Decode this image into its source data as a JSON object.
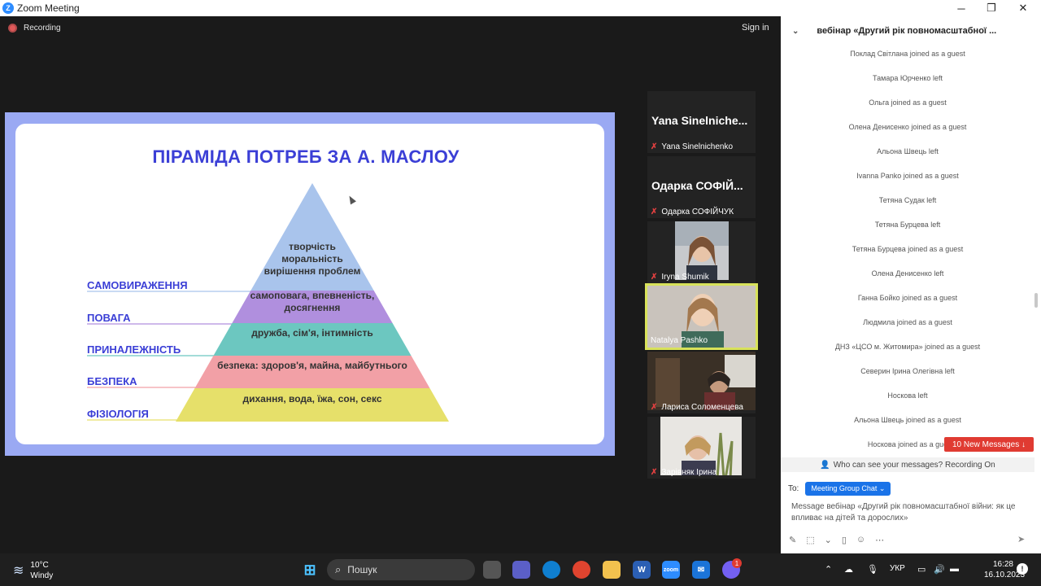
{
  "window": {
    "title": "Zoom Meeting",
    "logo_letter": "Z",
    "minimize": "─",
    "maximize": "❐",
    "close": "✕"
  },
  "meeting": {
    "recording_label": "Recording",
    "signin_label": "Sign in"
  },
  "slide": {
    "title": "ПІРАМІДА ПОТРЕБ ЗА А. МАСЛОУ",
    "levels": [
      {
        "label": "САМОВИРАЖЕННЯ",
        "lines": [
          "творчість",
          "моральність",
          "вирішення проблем"
        ],
        "color": "#a9c4ec"
      },
      {
        "label": "ПОВАГА",
        "lines": [
          "самоповага, впевненість,",
          "досягнення"
        ],
        "color": "#b08fde"
      },
      {
        "label": "ПРИНАЛЕЖНІСТЬ",
        "lines": [
          "дружба, сім'я, інтимність"
        ],
        "color": "#6cc7c0"
      },
      {
        "label": "БЕЗПЕКА",
        "lines": [
          "безпека: здоров'я, майна, майбутнього"
        ],
        "color": "#f2a0a6"
      },
      {
        "label": "ФІЗІОЛОГІЯ",
        "lines": [
          "дихання, вода, їжа, сон, секс"
        ],
        "color": "#e6e06a"
      }
    ]
  },
  "participants": [
    {
      "display": "Yana  Sinelniche...",
      "name": "Yana Sinelnichenko",
      "muted": true,
      "video": false
    },
    {
      "display": "Одарка  СОФІЙ...",
      "name": "Одарка СОФІЙЧУК",
      "muted": true,
      "video": false
    },
    {
      "name": "Iryna Shumik",
      "muted": true,
      "video": true
    },
    {
      "name": "Natalya Pashko",
      "muted": false,
      "video": true,
      "active": true
    },
    {
      "name": "Лариса Соломенцева",
      "muted": true,
      "video": true
    },
    {
      "name": "Зарівняк Ірина",
      "muted": true,
      "video": true
    }
  ],
  "chat": {
    "title": "вебінар «Другий рік повномасштабної ...",
    "messages": [
      "Поклад Світлана joined as a guest",
      "Тамара Юрченко left",
      "Ольга joined as a guest",
      "Олена Денисенко joined as a guest",
      "Альона Швець left",
      "Ivanna Panko joined as a guest",
      "Тетяна Судак left",
      "Тетяна Бурцева left",
      "Тетяна Бурцева joined as a guest",
      "Олена Денисенко left",
      "Ганна  Бойко joined as a guest",
      "Людмила joined as a guest",
      "ДНЗ «ЦСО м. Житомира» joined as a guest",
      "Северин Ірина Олегівна left",
      "Носкова left",
      "Альона Швець joined as a guest",
      "Носкова joined as a gue"
    ],
    "new_messages": "10 New Messages ↓",
    "privacy_note": "Who can see your messages? Recording On",
    "to_label": "To:",
    "to_value": "Meeting Group Chat ⌄",
    "input_placeholder": "Message вебінар «Другий рік повномасштабної війни: як це впливає на дітей та дорослих»"
  },
  "taskbar": {
    "weather_temp": "10°C",
    "weather_desc": "Windy",
    "search_placeholder": "Пошук",
    "language": "УКР",
    "time": "16:28",
    "date": "16.10.2023",
    "viber_badge": "1",
    "zoom_label": "zoom",
    "notif": "!"
  },
  "colors": {
    "accent": "#2D8CFF",
    "slide_border": "#9aa9f3",
    "title_blue": "#3b3fd6",
    "alert_red": "#e03b32"
  }
}
